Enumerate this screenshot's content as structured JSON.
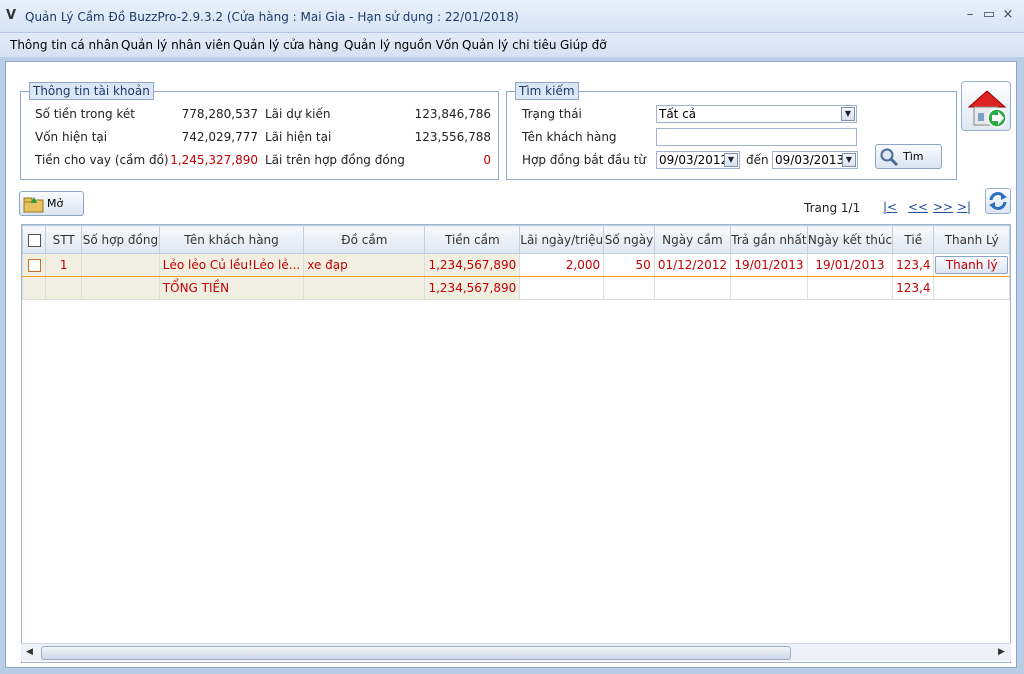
{
  "window": {
    "title": "Quản Lý Cầm Đồ BuzzPro-2.9.3.2 (Cửa hàng : Mai Gia - Hạn sử dụng : 22/01/2018)",
    "minimize": "–",
    "maximize": "▭",
    "close": "×"
  },
  "menu": [
    "Thông tin cá nhân",
    "Quản lý nhân viên",
    "Quản lý cửa hàng",
    "Quản lý nguồn Vốn",
    "Quản lý chi tiêu",
    "Giúp đỡ"
  ],
  "account": {
    "legend": "Thông tin tài khoản",
    "rows": [
      {
        "label": "Số tiền trong két",
        "value": "778,280,537",
        "label2": "Lãi dự kiến",
        "value2": "123,846,786"
      },
      {
        "label": "Vốn hiện tại",
        "value": "742,029,777",
        "label2": "Lãi hiện tại",
        "value2": "123,556,788"
      },
      {
        "label": "Tiền cho vay (cầm đồ)",
        "value": "1,245,327,890",
        "label2": "Lãi trên hợp đồng đóng",
        "value2": "0"
      }
    ]
  },
  "search": {
    "legend": "Tìm kiếm",
    "status_label": "Trạng thái",
    "status_value": "Tất cả",
    "customer_label": "Tên khách hàng",
    "customer_value": "",
    "from_label": "Hợp đồng bắt đầu từ",
    "from_date": "09/03/2012",
    "to_label": "đến",
    "to_date": "09/03/2013",
    "search_button": "Tìm"
  },
  "toolbar": {
    "open_button": "Mở",
    "pager": "Trang 1/1",
    "first": "|<",
    "prev": "<<",
    "next": ">>",
    "last": ">|"
  },
  "table": {
    "headers": [
      "",
      "STT",
      "Số hợp đồng",
      "Tên khách hàng",
      "Đồ cầm",
      "Tiền cầm",
      "Lãi ngày/triệu",
      "Số ngày",
      "Ngày cầm",
      "Trả gần nhất",
      "Ngày kết thúc",
      "Tiề",
      "Thanh Lý"
    ],
    "rows": [
      {
        "stt": "1",
        "contract": "",
        "customer": "Lẻo lẻo Củ lều!Lẻo lẻ...",
        "item": "xe đạp",
        "amount": "1,234,567,890",
        "rate": "2,000",
        "days": "50",
        "pawn_date": "01/12/2012",
        "last_paid": "19/01/2013",
        "end_date": "19/01/2013",
        "interest": "123,4",
        "action": "Thanh lý"
      }
    ],
    "total": {
      "label": "TỔNG TIỀN",
      "amount": "1,234,567,890",
      "interest": "123,4"
    }
  }
}
